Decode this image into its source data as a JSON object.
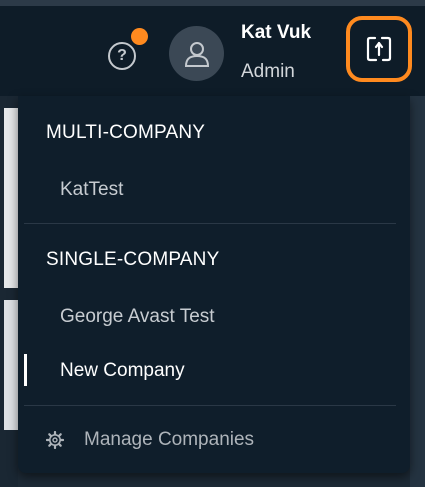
{
  "header": {
    "user": {
      "name": "Kat Vuk",
      "role": "Admin"
    },
    "icons": {
      "help": "question-circle-icon",
      "notification": "notification-dot",
      "avatar": "user-icon",
      "switch": "switch-company-icon"
    },
    "help_glyph": "?"
  },
  "dropdown": {
    "multi_company": {
      "title": "MULTI-COMPANY",
      "items": [
        "KatTest"
      ]
    },
    "single_company": {
      "title": "SINGLE-COMPANY",
      "items": [
        "George Avast Test",
        "New Company"
      ]
    },
    "selected": "New Company",
    "manage_label": "Manage Companies",
    "manage_icon": "gear-icon"
  },
  "colors": {
    "accent": "#ff8a1f",
    "panel": "#0f1e2b",
    "header": "#0e1c28",
    "text": "#ffffff",
    "muted": "#c7ccd1"
  }
}
